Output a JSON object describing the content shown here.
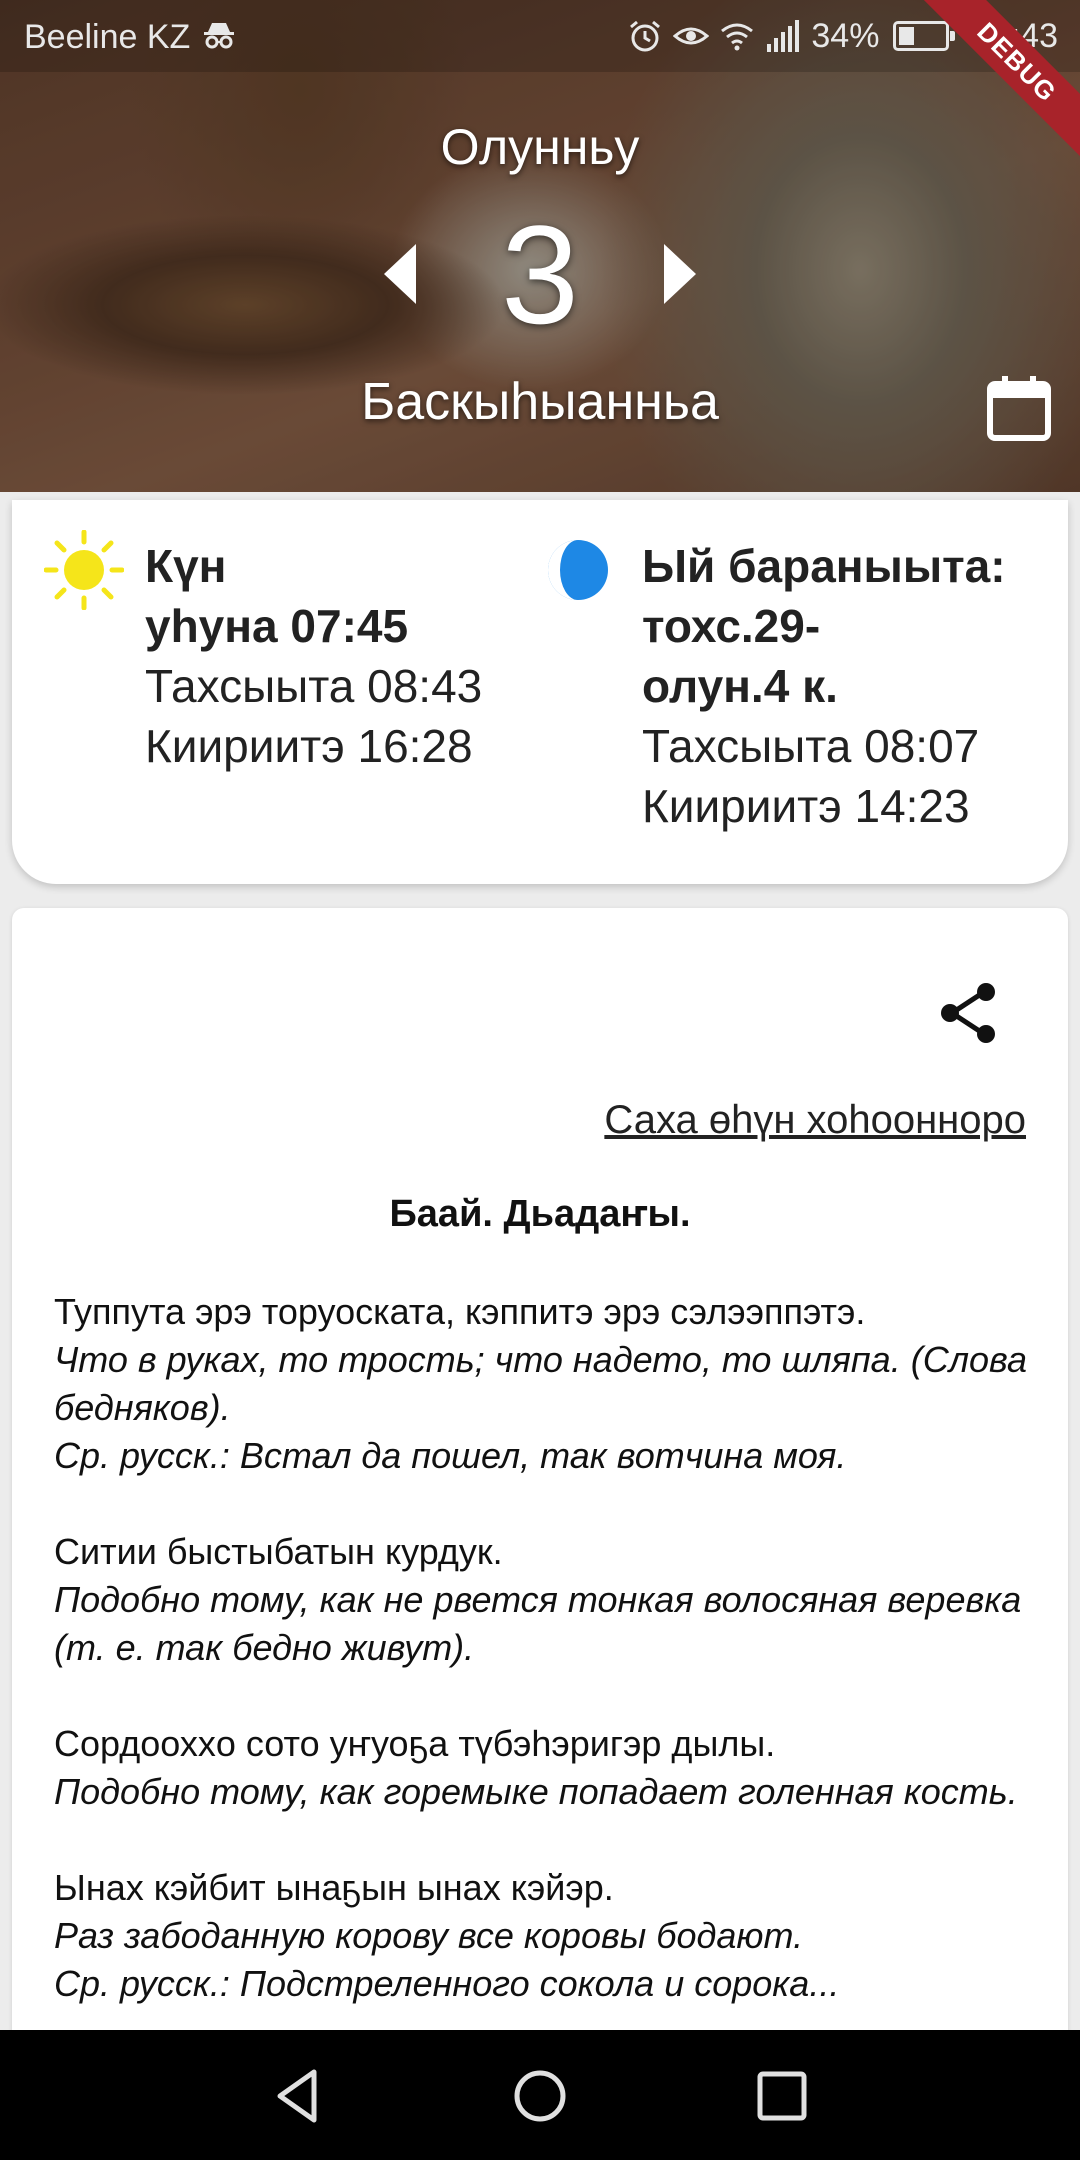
{
  "status_bar": {
    "carrier": "Beeline KZ",
    "battery_percent": "34%",
    "battery_level": 0.34,
    "time": "11:43",
    "icons": [
      "incognito-icon",
      "alarm-icon",
      "eye-comfort-icon",
      "wifi-icon",
      "signal-icon",
      "battery-icon"
    ]
  },
  "debug_banner": "DEBUG",
  "date_nav": {
    "month": "Олунньу",
    "day": "3",
    "weekday": "Баскыһыанньа"
  },
  "sun": {
    "title_line1": "Күн",
    "title_line2": "уһуна 07:45",
    "rise": "Тахсыыта 08:43",
    "set": "Киириитэ 16:28"
  },
  "moon": {
    "title_line1": "Ый бараныыта:",
    "title_line2": "тохс.29-",
    "title_line3": "олун.4 к.",
    "rise": "Тахсыыта 08:07",
    "set": "Киириитэ 14:23"
  },
  "content": {
    "source_link": "Саха өһүн хоһооннорo",
    "section_title": "Баай. Дьадаҥы.",
    "proverbs": [
      {
        "text": "Туппута эрэ торуоската, кэппитэ эрэ сэлээппэтэ.",
        "translation": "Что в руках, то трость; что надето, то шляпа. (Слова бедняков).",
        "note": "Ср. русск.: Встал да пошел, так вотчина моя."
      },
      {
        "text": "Ситии быстыбатын курдук.",
        "translation": "Подобно тому, как не рвется тонкая волосяная веревка (т. е. так бедно живут).",
        "note": ""
      },
      {
        "text": "Сордоохxо сото уҥуоҕа түбэһэригэр дылы.",
        "translation": "Подобно тому, как горемыке попадает голенная кость.",
        "note": ""
      },
      {
        "text": "Ынах кэйбит ынаҕын ынах кэйэр.",
        "translation": "Раз забоданную корову все коровы бодают.",
        "note": "Ср. русск.: Подстреленного сокола и сорока..."
      }
    ]
  },
  "colors": {
    "ribbon": "#a8232a",
    "sun": "#f5e51a",
    "moon": "#1e88e5",
    "card": "#ffffff",
    "navbar": "#000000"
  }
}
